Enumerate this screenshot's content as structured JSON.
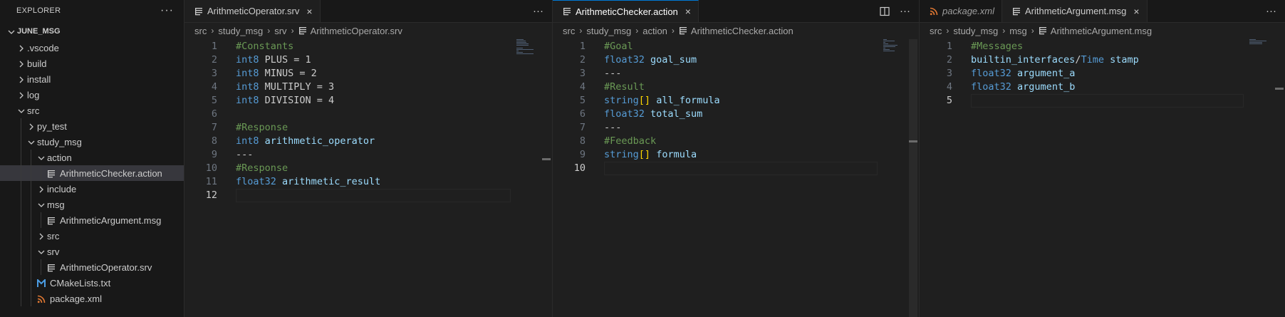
{
  "sidebar": {
    "title": "EXPLORER",
    "more": "···",
    "workspace": "JUNE_MSG",
    "items": [
      {
        "label": ".vscode",
        "kind": "folder",
        "open": false,
        "depth": 1
      },
      {
        "label": "build",
        "kind": "folder",
        "open": false,
        "depth": 1
      },
      {
        "label": "install",
        "kind": "folder",
        "open": false,
        "depth": 1
      },
      {
        "label": "log",
        "kind": "folder",
        "open": false,
        "depth": 1
      },
      {
        "label": "src",
        "kind": "folder",
        "open": true,
        "depth": 1
      },
      {
        "label": "py_test",
        "kind": "folder",
        "open": false,
        "depth": 2
      },
      {
        "label": "study_msg",
        "kind": "folder",
        "open": true,
        "depth": 2
      },
      {
        "label": "action",
        "kind": "folder",
        "open": true,
        "depth": 3
      },
      {
        "label": "ArithmeticChecker.action",
        "kind": "file",
        "icon": "lines-icon",
        "depth": 4,
        "selected": true
      },
      {
        "label": "include",
        "kind": "folder",
        "open": false,
        "depth": 3
      },
      {
        "label": "msg",
        "kind": "folder",
        "open": true,
        "depth": 3
      },
      {
        "label": "ArithmeticArgument.msg",
        "kind": "file",
        "icon": "lines-icon",
        "depth": 4
      },
      {
        "label": "src",
        "kind": "folder",
        "open": false,
        "depth": 3
      },
      {
        "label": "srv",
        "kind": "folder",
        "open": true,
        "depth": 3
      },
      {
        "label": "ArithmeticOperator.srv",
        "kind": "file",
        "icon": "lines-icon",
        "depth": 4
      },
      {
        "label": "CMakeLists.txt",
        "kind": "file",
        "icon": "cmake-icon",
        "depth": 3
      },
      {
        "label": "package.xml",
        "kind": "file",
        "icon": "rss-icon",
        "depth": 3
      }
    ]
  },
  "groups": [
    {
      "tabs": [
        {
          "label": "ArithmeticOperator.srv",
          "state": "inactive-focused",
          "close": "×",
          "icon": "lines-icon"
        }
      ],
      "actions": [
        "···"
      ],
      "breadcrumb": [
        "src",
        "study_msg",
        "srv",
        "ArithmeticOperator.srv"
      ],
      "current_line": 12,
      "lines": [
        [
          [
            "cm",
            "#Constants"
          ]
        ],
        [
          [
            "kw",
            "int8"
          ],
          [
            "plain",
            " PLUS = 1"
          ]
        ],
        [
          [
            "kw",
            "int8"
          ],
          [
            "plain",
            " MINUS = 2"
          ]
        ],
        [
          [
            "kw",
            "int8"
          ],
          [
            "plain",
            " MULTIPLY = 3"
          ]
        ],
        [
          [
            "kw",
            "int8"
          ],
          [
            "plain",
            " DIVISION = 4"
          ]
        ],
        [],
        [
          [
            "cm",
            "#Response"
          ]
        ],
        [
          [
            "kw",
            "int8"
          ],
          [
            "plain",
            " "
          ],
          [
            "id",
            "arithmetic_operator"
          ]
        ],
        [
          [
            "plain",
            "---"
          ]
        ],
        [
          [
            "cm",
            "#Response"
          ]
        ],
        [
          [
            "kw",
            "float32"
          ],
          [
            "plain",
            " "
          ],
          [
            "id",
            "arithmetic_result"
          ]
        ],
        []
      ]
    },
    {
      "tabs": [
        {
          "label": "ArithmeticChecker.action",
          "state": "active",
          "close": "×",
          "icon": "lines-icon"
        }
      ],
      "actions": [
        "split-editor-icon",
        "···"
      ],
      "breadcrumb": [
        "src",
        "study_msg",
        "action",
        "ArithmeticChecker.action"
      ],
      "current_line": 10,
      "lines": [
        [
          [
            "cm",
            "#Goal"
          ]
        ],
        [
          [
            "kw",
            "float32"
          ],
          [
            "plain",
            " "
          ],
          [
            "id",
            "goal_sum"
          ]
        ],
        [
          [
            "plain",
            "---"
          ]
        ],
        [
          [
            "cm",
            "#Result"
          ]
        ],
        [
          [
            "kw",
            "string"
          ],
          [
            "br",
            "[]"
          ],
          [
            "plain",
            " "
          ],
          [
            "id",
            "all_formula"
          ]
        ],
        [
          [
            "kw",
            "float32"
          ],
          [
            "plain",
            " "
          ],
          [
            "id",
            "total_sum"
          ]
        ],
        [
          [
            "plain",
            "---"
          ]
        ],
        [
          [
            "cm",
            "#Feedback"
          ]
        ],
        [
          [
            "kw",
            "string"
          ],
          [
            "br",
            "[]"
          ],
          [
            "plain",
            " "
          ],
          [
            "id",
            "formula"
          ]
        ],
        []
      ]
    },
    {
      "tabs": [
        {
          "label": "package.xml",
          "state": "inactive",
          "italic": true,
          "icon": "rss-icon"
        },
        {
          "label": "ArithmeticArgument.msg",
          "state": "inactive-focused",
          "close": "×",
          "icon": "lines-icon"
        }
      ],
      "actions": [
        "···"
      ],
      "breadcrumb": [
        "src",
        "study_msg",
        "msg",
        "ArithmeticArgument.msg"
      ],
      "current_line": 5,
      "lines": [
        [
          [
            "cm",
            "#Messages"
          ]
        ],
        [
          [
            "id",
            "builtin_interfaces"
          ],
          [
            "plain",
            "/"
          ],
          [
            "kw",
            "Time"
          ],
          [
            "plain",
            " "
          ],
          [
            "id",
            "stamp"
          ]
        ],
        [
          [
            "kw",
            "float32"
          ],
          [
            "plain",
            " "
          ],
          [
            "id",
            "argument_a"
          ]
        ],
        [
          [
            "kw",
            "float32"
          ],
          [
            "plain",
            " "
          ],
          [
            "id",
            "argument_b"
          ]
        ],
        []
      ]
    }
  ],
  "colors": {
    "accent": "#0078d4",
    "keyword": "#569cd6",
    "comment": "#6a9955",
    "identifier": "#9cdcfe",
    "bracket": "#ffd700",
    "rss": "#e37933",
    "cmake": "#4b9ce2"
  }
}
